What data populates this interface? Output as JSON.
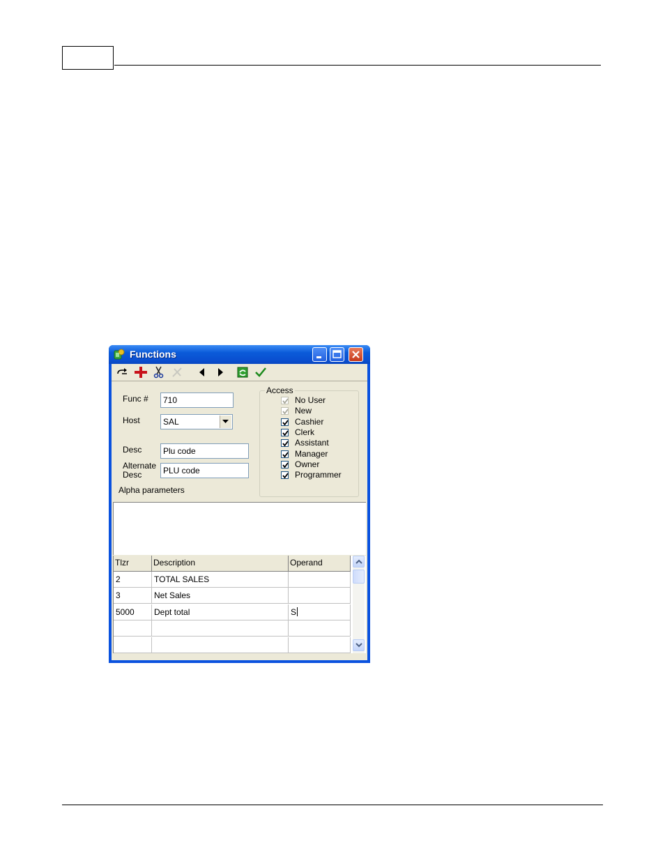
{
  "window": {
    "title": "Functions",
    "titlebar_color": "#0a52df"
  },
  "toolbar": {
    "icons": [
      "redo-icon",
      "add-icon",
      "cut-icon",
      "delete-icon",
      "previous-icon",
      "next-icon",
      "refresh-icon",
      "confirm-icon"
    ]
  },
  "form": {
    "func_label": "Func #",
    "func_value": "710",
    "host_label": "Host",
    "host_value": "SAL",
    "desc_label": "Desc",
    "desc_value": "Plu code",
    "alt_desc_label_1": "Alternate",
    "alt_desc_label_2": "Desc",
    "alt_desc_value": "PLU code",
    "alpha_params_label": "Alpha parameters"
  },
  "access": {
    "title": "Access",
    "items": [
      {
        "label": "No User",
        "checked": true,
        "disabled": true
      },
      {
        "label": "New",
        "checked": true,
        "disabled": true
      },
      {
        "label": "Cashier",
        "checked": true,
        "disabled": false
      },
      {
        "label": "Clerk",
        "checked": true,
        "disabled": false
      },
      {
        "label": "Assistant",
        "checked": true,
        "disabled": false
      },
      {
        "label": "Manager",
        "checked": true,
        "disabled": false
      },
      {
        "label": "Owner",
        "checked": true,
        "disabled": false
      },
      {
        "label": "Programmer",
        "checked": true,
        "disabled": false
      }
    ]
  },
  "grid": {
    "columns": [
      "Tlzr",
      "Description",
      "Operand"
    ],
    "rows": [
      [
        "2",
        "TOTAL SALES",
        ""
      ],
      [
        "3",
        "Net Sales",
        ""
      ],
      [
        "5000",
        "Dept total",
        "S"
      ],
      [
        "",
        "",
        ""
      ],
      [
        "",
        "",
        ""
      ]
    ]
  }
}
